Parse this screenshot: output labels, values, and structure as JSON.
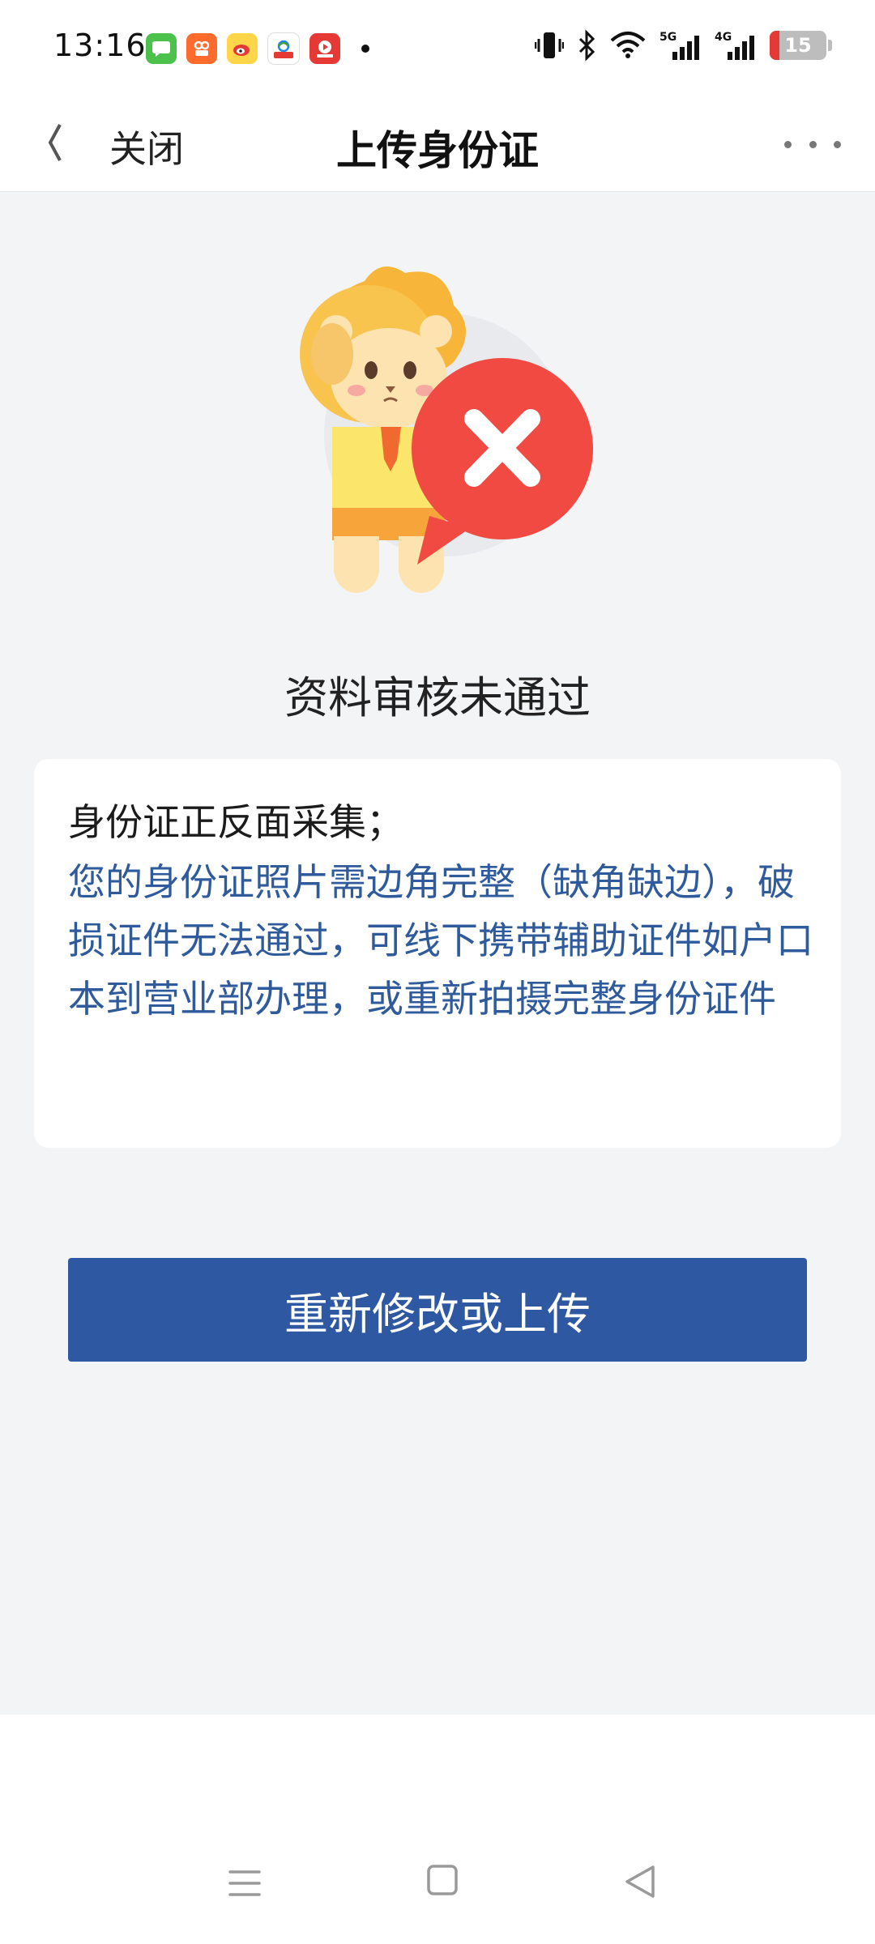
{
  "status_bar": {
    "time": "13:16",
    "battery_level": "15",
    "network_labels": [
      "5G",
      "4G"
    ],
    "notification_icons": [
      "messages-icon",
      "app-icon-orange",
      "weibo-icon",
      "mobile-operator-icon",
      "video-app-icon"
    ]
  },
  "nav": {
    "back_icon": "chevron-left-icon",
    "close_label": "关闭",
    "title": "上传身份证",
    "more_icon": "more-dots-icon"
  },
  "result": {
    "title": "资料审核未通过",
    "status_icon": "error-x-icon"
  },
  "card": {
    "title": "身份证正反面采集；",
    "description": "您的身份证照片需边角完整（缺角缺边），破损证件无法通过，可线下携带辅助证件如户口本到营业部办理，或重新拍摄完整身份证件"
  },
  "actions": {
    "primary_label": "重新修改或上传"
  },
  "colors": {
    "accent": "#2f58a2",
    "link_text": "#2f5b9c",
    "error": "#f04a43",
    "background": "#f3f4f6"
  }
}
